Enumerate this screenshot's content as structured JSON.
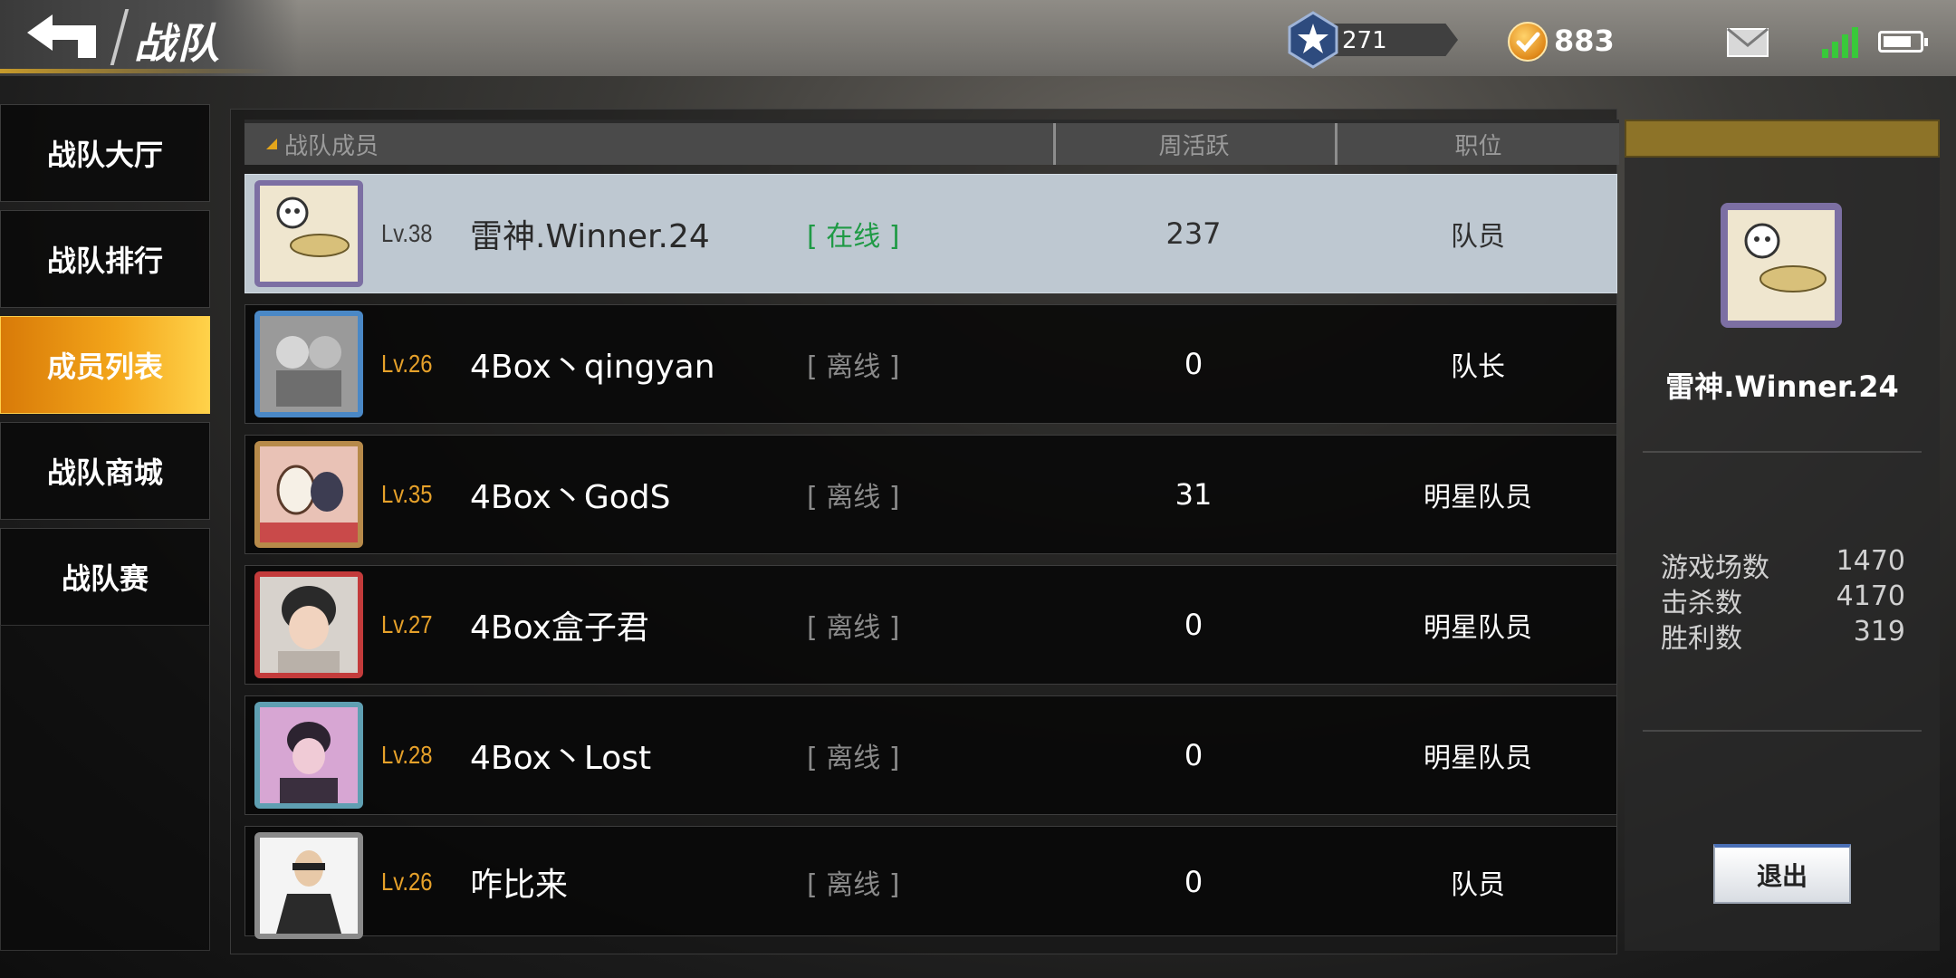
{
  "header": {
    "title": "战队",
    "rank_value": "271",
    "coins": "883"
  },
  "sidebar": {
    "items": [
      {
        "label": "战队大厅"
      },
      {
        "label": "战队排行"
      },
      {
        "label": "成员列表"
      },
      {
        "label": "战队商城"
      },
      {
        "label": "战队赛"
      }
    ],
    "active_index": 2
  },
  "table": {
    "headers": {
      "members": "战队成员",
      "weekly": "周活跃",
      "role": "职位"
    },
    "rows": [
      {
        "level": "Lv.38",
        "name": "雷神.Winner.24",
        "status": "[ 在线 ]",
        "weekly": "237",
        "role": "队员"
      },
      {
        "level": "Lv.26",
        "name": "4Box丶qingyan",
        "status": "[ 离线 ]",
        "weekly": "0",
        "role": "队长"
      },
      {
        "level": "Lv.35",
        "name": "4Box丶GodS",
        "status": "[ 离线 ]",
        "weekly": "31",
        "role": "明星队员"
      },
      {
        "level": "Lv.27",
        "name": "4Box盒子君",
        "status": "[ 离线 ]",
        "weekly": "0",
        "role": "明星队员"
      },
      {
        "level": "Lv.28",
        "name": "4Box丶Lost",
        "status": "[ 离线 ]",
        "weekly": "0",
        "role": "明星队员"
      },
      {
        "level": "Lv.26",
        "name": "咋比来",
        "status": "[ 离线 ]",
        "weekly": "0",
        "role": "队员"
      }
    ]
  },
  "detail": {
    "name": "雷神.Winner.24",
    "stats": [
      {
        "label": "游戏场数",
        "value": "1470"
      },
      {
        "label": "击杀数",
        "value": "4170"
      },
      {
        "label": "胜利数",
        "value": "319"
      }
    ],
    "exit_label": "退出"
  },
  "colors": {
    "accent_orange": "#f3a51a",
    "level_gold": "#e6a12a",
    "online_green": "#1f9a45",
    "selected_row": "#bec8d1"
  },
  "icons": [
    "back-arrow-icon",
    "rank-badge-icon",
    "coin-icon",
    "mail-icon",
    "signal-icon",
    "battery-icon"
  ]
}
